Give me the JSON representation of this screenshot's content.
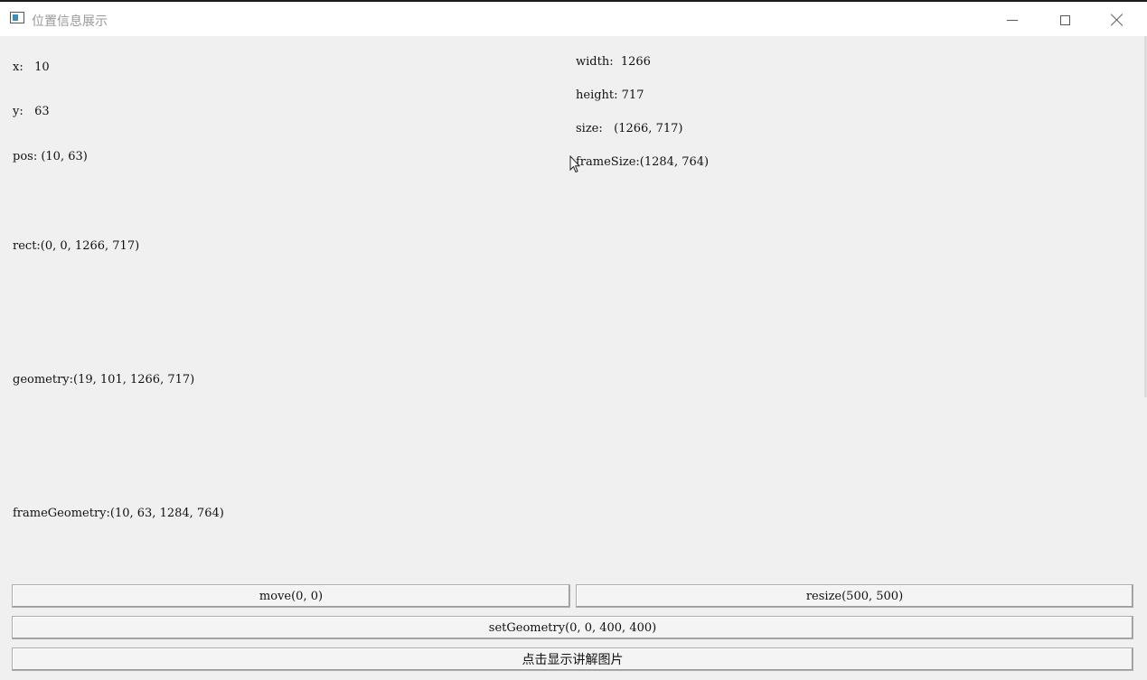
{
  "window": {
    "title": "位置信息展示"
  },
  "left_info": {
    "x": "x:   10",
    "y": "y:   63",
    "pos": "pos: (10, 63)",
    "rect": "rect:(0, 0, 1266, 717)",
    "geometry": "geometry:(19, 101, 1266, 717)",
    "frame_geometry": "frameGeometry:(10, 63, 1284, 764)"
  },
  "right_info": {
    "width": "width:  1266",
    "height": "height: 717",
    "size": "size:   (1266, 717)",
    "frame_size": "frameSize:(1284, 764)"
  },
  "buttons": {
    "move": "move(0, 0)",
    "resize": "resize(500, 500)",
    "set_geometry": "setGeometry(0, 0, 400, 400)",
    "show_picture": "点击显示讲解图片"
  },
  "icons": {
    "app": "app-window-icon",
    "minimize": "minimize-icon",
    "maximize": "maximize-icon",
    "close": "close-icon",
    "cursor": "mouse-cursor-icon"
  }
}
